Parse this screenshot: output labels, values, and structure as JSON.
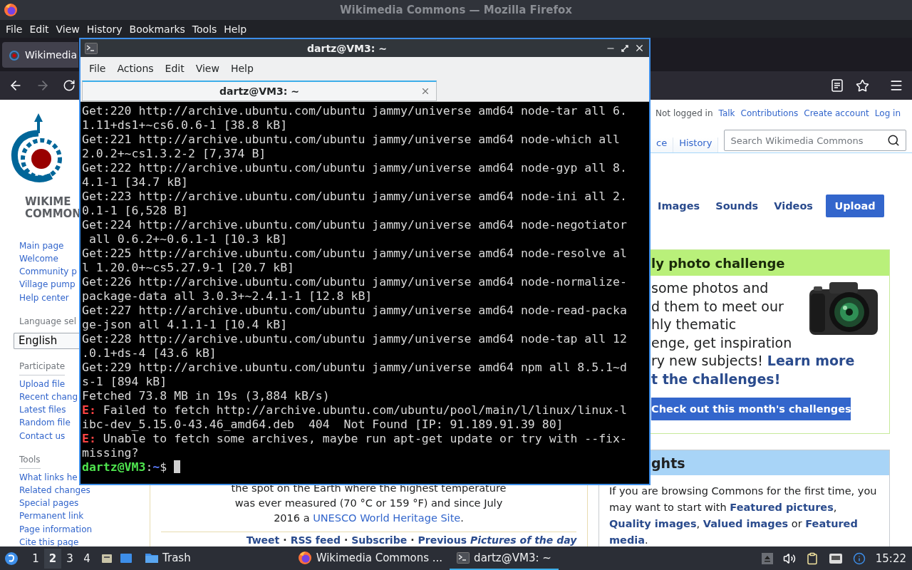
{
  "browser": {
    "window_title": "Wikimedia Commons — Mozilla Firefox",
    "menu": [
      "File",
      "Edit",
      "View",
      "History",
      "Bookmarks",
      "Tools",
      "Help"
    ],
    "tab": {
      "label": "Wikimedia"
    },
    "nav": {
      "forward_disabled": true
    }
  },
  "page": {
    "logo_lines": [
      "WIKIME",
      "COMMON"
    ],
    "sidebar": [
      {
        "items": [
          "Main page",
          "Welcome",
          "Community p",
          "Village pump",
          "Help center"
        ]
      },
      {
        "heading": "Language sel",
        "select": "English"
      },
      {
        "heading": "Participate",
        "items": [
          "Upload file",
          "Recent chang",
          "Latest files",
          "Random file",
          "Contact us"
        ]
      },
      {
        "heading": "Tools",
        "items": [
          "What links he",
          "Related changes",
          "Special pages",
          "Permanent link",
          "Page information",
          "Cite this page"
        ]
      }
    ],
    "personal": [
      {
        "label": "Not logged in",
        "kind": "status"
      },
      {
        "label": "Talk",
        "kind": "link"
      },
      {
        "label": "Contributions",
        "kind": "link"
      },
      {
        "label": "Create account",
        "kind": "link"
      },
      {
        "label": "Log in",
        "kind": "link"
      }
    ],
    "page_tabs": [
      {
        "label": "ce",
        "selected": false
      },
      {
        "label": "History",
        "selected": false
      }
    ],
    "search": {
      "placeholder": "Search Wikimedia Commons"
    },
    "media_links": [
      "Images",
      "Sounds",
      "Videos"
    ],
    "upload_button": "Upload",
    "challenge": {
      "heading": "ly photo challenge",
      "lines": [
        {
          "text": "some photos and",
          "link": false
        },
        {
          "text": "d them to meet our",
          "link": false
        },
        {
          "text": "hly thematic",
          "link": false
        },
        {
          "text": "enge, get inspiration",
          "link": false
        },
        {
          "text": "ry new subjects! **Learn more**",
          "link": false
        },
        {
          "text": "t the challenges!",
          "link": true
        }
      ],
      "button": "Check out this month's challenges"
    },
    "highlights": {
      "heading": "ghts",
      "text": "If you are browsing Commons for the first time, you may want to start with **Featured pictures**, **Quality images**, **Valued images** or **Featured media**."
    },
    "caption": {
      "lines": [
        "the spot on the Earth where the highest temperature",
        "was ever measured (70 °C or 159 °F) and since July"
      ],
      "last_line": {
        "before": "2016 a ",
        "link": "UNESCO World Heritage Site",
        "after": "."
      }
    },
    "footer_links": {
      "separator": "·",
      "links": [
        "Tweet",
        "RSS feed",
        "Subscribe"
      ],
      "previous": {
        "label": "Previous",
        "title": "Pictures of the day"
      }
    }
  },
  "terminal": {
    "title": "dartz@VM3: ~",
    "menu": [
      "File",
      "Actions",
      "Edit",
      "View",
      "Help"
    ],
    "tab": {
      "label": "dartz@VM3: ~",
      "selected": true
    },
    "lines": [
      {
        "kind": "normal",
        "text": "Get:220 http://archive.ubuntu.com/ubuntu jammy/universe amd64 node-tar all 6."
      },
      {
        "kind": "normal",
        "text": "1.11+ds1+~cs6.0.6-1 [38.8 kB]"
      },
      {
        "kind": "normal",
        "text": "Get:221 http://archive.ubuntu.com/ubuntu jammy/universe amd64 node-which all"
      },
      {
        "kind": "normal",
        "text": "2.0.2+~cs1.3.2-2 [7,374 B]"
      },
      {
        "kind": "normal",
        "text": "Get:222 http://archive.ubuntu.com/ubuntu jammy/universe amd64 node-gyp all 8."
      },
      {
        "kind": "normal",
        "text": "4.1-1 [34.7 kB]"
      },
      {
        "kind": "normal",
        "text": "Get:223 http://archive.ubuntu.com/ubuntu jammy/universe amd64 node-ini all 2."
      },
      {
        "kind": "normal",
        "text": "0.1-1 [6,528 B]"
      },
      {
        "kind": "normal",
        "text": "Get:224 http://archive.ubuntu.com/ubuntu jammy/universe amd64 node-negotiator"
      },
      {
        "kind": "normal",
        "text": " all 0.6.2+~0.6.1-1 [10.3 kB]"
      },
      {
        "kind": "normal",
        "text": "Get:225 http://archive.ubuntu.com/ubuntu jammy/universe amd64 node-resolve al"
      },
      {
        "kind": "normal",
        "text": "l 1.20.0+~cs5.27.9-1 [20.7 kB]"
      },
      {
        "kind": "normal",
        "text": "Get:226 http://archive.ubuntu.com/ubuntu jammy/universe amd64 node-normalize-"
      },
      {
        "kind": "normal",
        "text": "package-data all 3.0.3+~2.4.1-1 [12.8 kB]"
      },
      {
        "kind": "normal",
        "text": "Get:227 http://archive.ubuntu.com/ubuntu jammy/universe amd64 node-read-packa"
      },
      {
        "kind": "normal",
        "text": "ge-json all 4.1.1-1 [10.4 kB]"
      },
      {
        "kind": "normal",
        "text": "Get:228 http://archive.ubuntu.com/ubuntu jammy/universe amd64 node-tap all 12"
      },
      {
        "kind": "normal",
        "text": ".0.1+ds-4 [43.6 kB]"
      },
      {
        "kind": "normal",
        "text": "Get:229 http://archive.ubuntu.com/ubuntu jammy/universe amd64 npm all 8.5.1~d"
      },
      {
        "kind": "normal",
        "text": "s-1 [894 kB]"
      },
      {
        "kind": "normal",
        "text": "Fetched 73.8 MB in 19s (3,884 kB/s)"
      },
      {
        "kind": "error",
        "prefix": "E:",
        "text": " Failed to fetch http://archive.ubuntu.com/ubuntu/pool/main/l/linux/linux-l"
      },
      {
        "kind": "normal",
        "text": "ibc-dev_5.15.0-43.46_amd64.deb  404  Not Found [IP: 91.189.91.39 80]"
      },
      {
        "kind": "error",
        "prefix": "E:",
        "text": " Unable to fetch some archives, maybe run apt-get update or try with --fix-"
      },
      {
        "kind": "normal",
        "text": "missing?"
      },
      {
        "kind": "prompt",
        "user": "dartz@VM3",
        "sep": ":",
        "path": "~",
        "symbol": "$"
      }
    ]
  },
  "taskbar": {
    "workspaces": [
      {
        "label": "1",
        "selected": false
      },
      {
        "label": "2",
        "selected": true
      },
      {
        "label": "3",
        "selected": false
      },
      {
        "label": "4",
        "selected": false
      }
    ],
    "trash": "Trash",
    "tasks": [
      {
        "label": "Wikimedia Commons ...",
        "kind": "browser",
        "selected": false
      },
      {
        "label": "dartz@VM3: ~",
        "kind": "terminal",
        "selected": true
      }
    ],
    "clock": "15:22"
  }
}
